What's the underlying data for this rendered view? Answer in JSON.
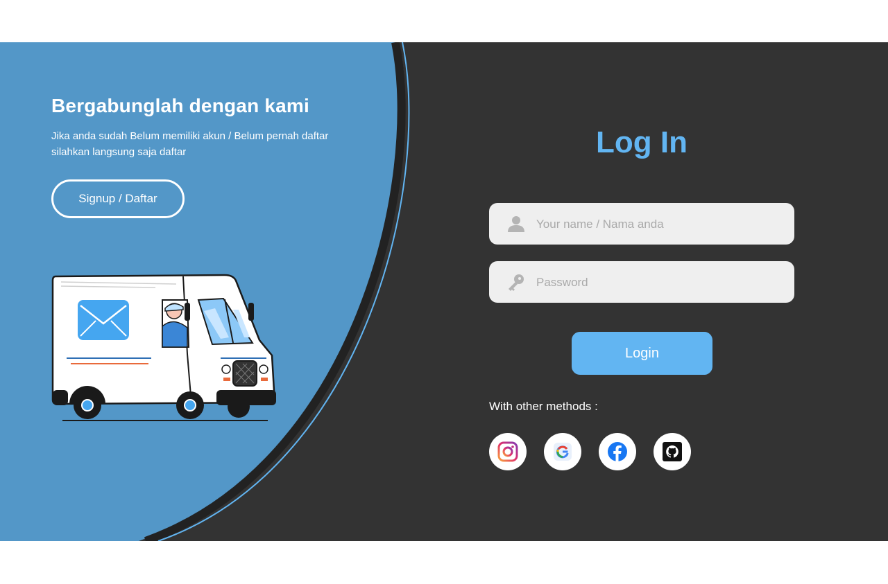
{
  "welcome": {
    "title": "Bergabunglah dengan kami",
    "description": "Jika anda sudah Belum memiliki akun / Belum pernah daftar silahkan langsung saja daftar",
    "signup_label": "Signup / Daftar",
    "illustration": "mail-van-illustration"
  },
  "login": {
    "title": "Log In",
    "username_placeholder": "Your name / Nama anda",
    "password_placeholder": "Password",
    "username_icon": "user-icon",
    "password_icon": "key-icon",
    "submit_label": "Login",
    "other_methods_label": "With other methods :",
    "social": [
      {
        "name": "instagram",
        "icon": "instagram-icon"
      },
      {
        "name": "google",
        "icon": "google-icon"
      },
      {
        "name": "facebook",
        "icon": "facebook-icon"
      },
      {
        "name": "github",
        "icon": "github-icon"
      }
    ]
  },
  "colors": {
    "left_panel": "#5397c8",
    "right_panel": "#333333",
    "accent": "#62b5f2",
    "input_bg": "#efefef",
    "page_bg": "#ffffff"
  }
}
